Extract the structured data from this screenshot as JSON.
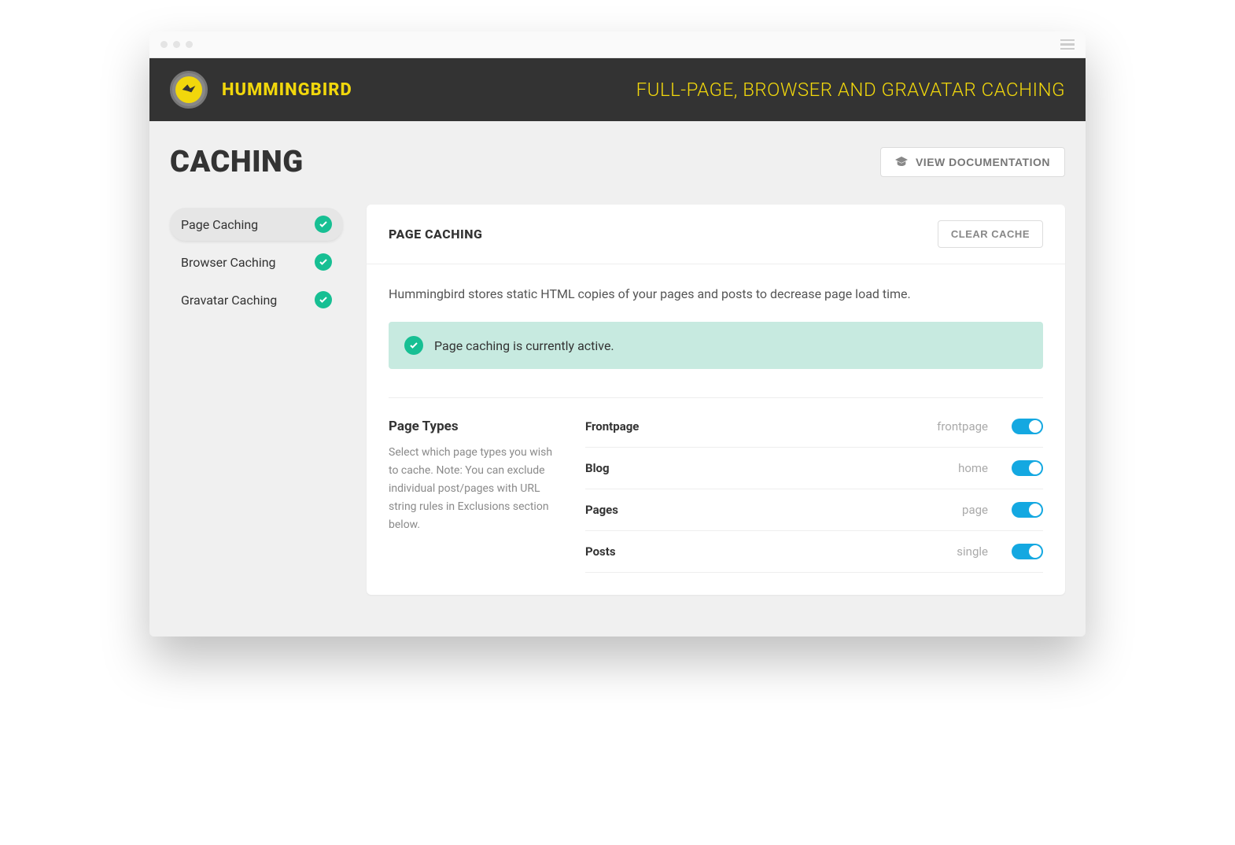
{
  "header": {
    "brand": "HUMMINGBIRD",
    "tagline": "FULL-PAGE, BROWSER AND GRAVATAR CACHING"
  },
  "page": {
    "title": "CACHING",
    "doc_button": "VIEW DOCUMENTATION"
  },
  "sidebar": {
    "items": [
      {
        "label": "Page Caching",
        "active": true
      },
      {
        "label": "Browser Caching",
        "active": false
      },
      {
        "label": "Gravatar Caching",
        "active": false
      }
    ]
  },
  "panel": {
    "title": "PAGE CACHING",
    "clear_button": "CLEAR CACHE",
    "description": "Hummingbird stores static HTML copies of your pages and posts to decrease page load time.",
    "notice": "Page caching is currently active."
  },
  "page_types": {
    "title": "Page Types",
    "description": "Select which page types you wish to cache. Note: You can exclude individual post/pages with URL string rules in Exclusions section below.",
    "rows": [
      {
        "label": "Frontpage",
        "id": "frontpage",
        "on": true
      },
      {
        "label": "Blog",
        "id": "home",
        "on": true
      },
      {
        "label": "Pages",
        "id": "page",
        "on": true
      },
      {
        "label": "Posts",
        "id": "single",
        "on": true
      }
    ]
  }
}
